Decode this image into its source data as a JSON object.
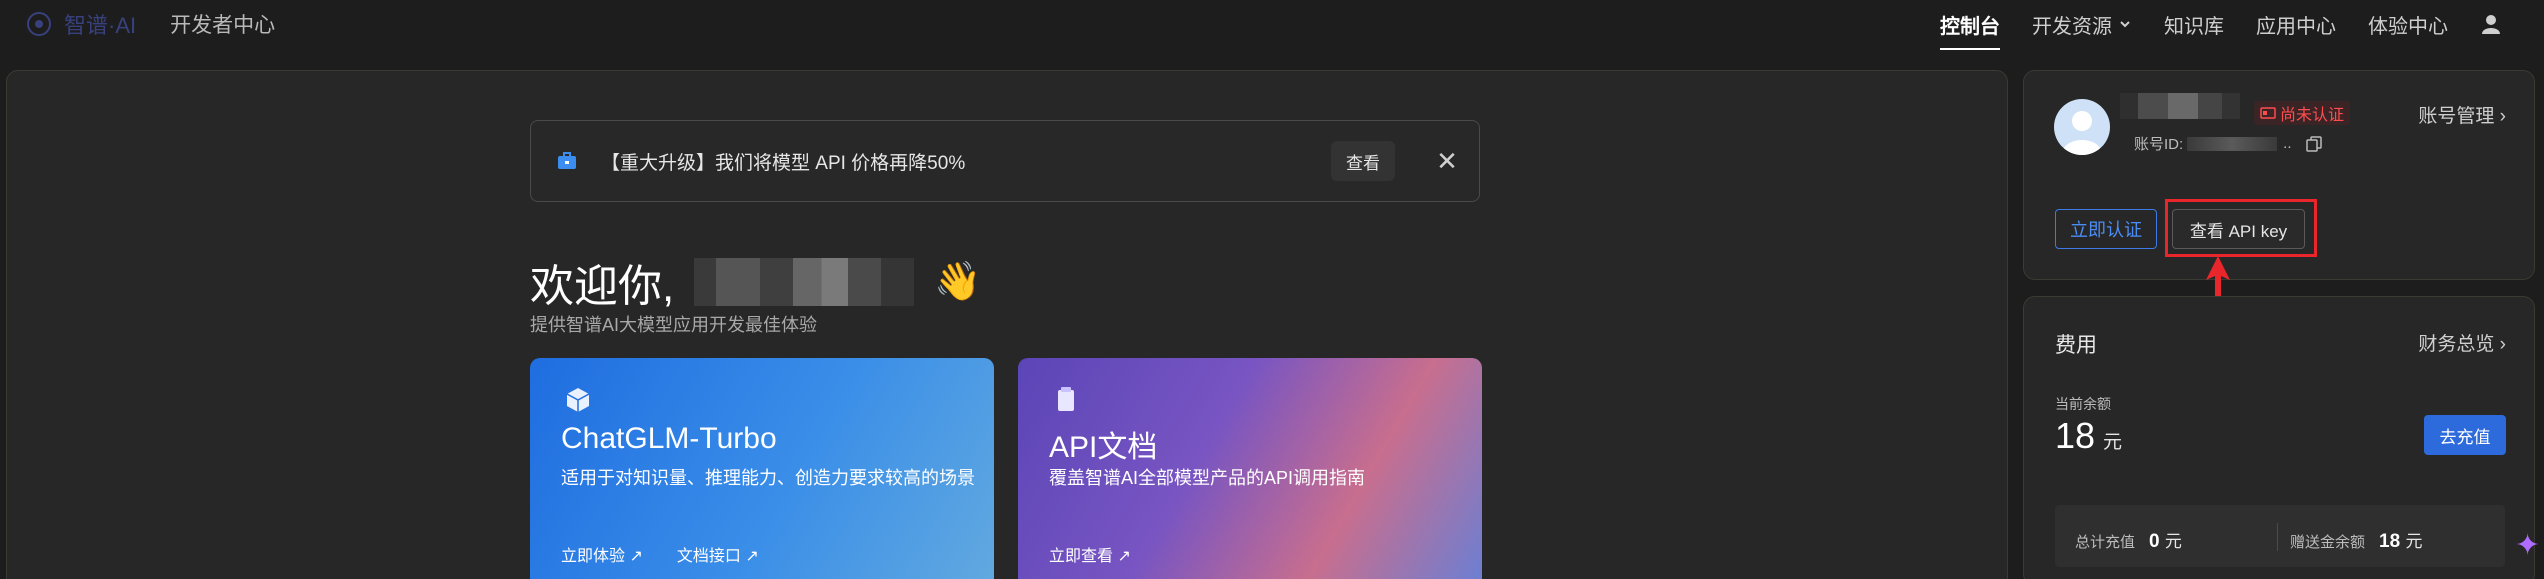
{
  "nav": {
    "brand": "智谱·AI",
    "dev_center": "开发者中心",
    "items": [
      {
        "label": "控制台"
      },
      {
        "label": "开发资源"
      },
      {
        "label": "知识库"
      },
      {
        "label": "应用中心"
      },
      {
        "label": "体验中心"
      }
    ]
  },
  "banner": {
    "text": "【重大升级】我们将模型 API 价格再降50%",
    "view": "查看"
  },
  "welcome": {
    "title": "欢迎你,",
    "wave": "👋",
    "subtitle": "提供智谱AI大模型应用开发最佳体验"
  },
  "cards": [
    {
      "title": "ChatGLM-Turbo",
      "desc": "适用于对知识量、推理能力、创造力要求较高的场景",
      "links": [
        "立即体验",
        "文档接口"
      ]
    },
    {
      "title": "API文档",
      "desc": "覆盖智谱AI全部模型产品的API调用指南",
      "links": [
        "立即查看"
      ]
    }
  ],
  "profile": {
    "badge": "尚未认证",
    "account_prefix": "账号ID: ",
    "account_suffix": "..",
    "account_manage": "账号管理",
    "verify": "立即认证",
    "view_key": "查看 API key"
  },
  "fee": {
    "title": "费用",
    "overview": "财务总览",
    "balance_label": "当前余额",
    "balance": "18",
    "unit": "元",
    "charge": "去充值",
    "total_label": "总计充值",
    "total_value": "0",
    "gift_label": "赠送金余额",
    "gift_value": "18"
  },
  "colors": {
    "accent": "#2d6bdc",
    "warn": "#ff4d4f",
    "highlight": "#e8262b"
  }
}
